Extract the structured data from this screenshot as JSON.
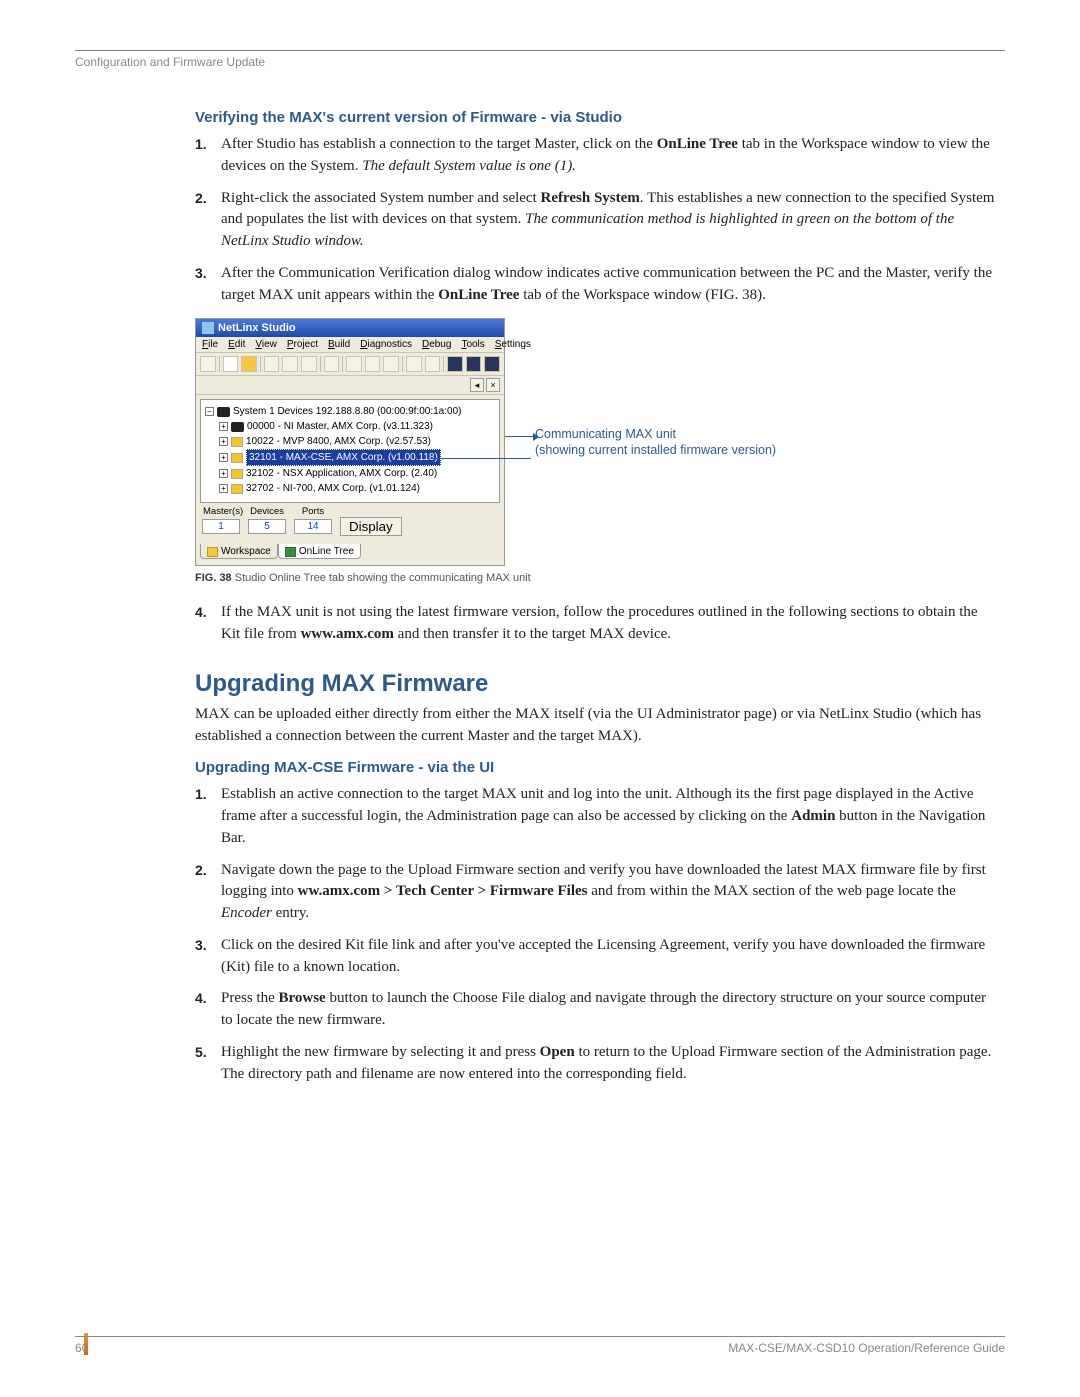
{
  "header": {
    "crumb": "Configuration and Firmware Update"
  },
  "sec1": {
    "title": "Verifying the MAX's current version of Firmware - via Studio",
    "steps": [
      {
        "n": "1.",
        "pre": "After Studio has establish a connection to the target Master, click on the ",
        "b1": "OnLine Tree",
        "mid": " tab in the Workspace window to view the devices on the System. ",
        "i1": "The default System value is one (1)."
      },
      {
        "n": "2.",
        "pre": "Right-click the associated System number and select ",
        "b1": "Refresh System",
        "mid": ". This establishes a new connection to the specified System and populates the list with devices on that system. ",
        "i1": "The communication method is highlighted in green on the bottom of the NetLinx Studio window."
      },
      {
        "n": "3.",
        "pre": "After the Communication Verification dialog window indicates active communication between the PC and the Master, verify the target MAX unit appears within the ",
        "b1": "OnLine Tree",
        "mid": " tab of the Workspace window (FIG. 38).",
        "i1": ""
      }
    ]
  },
  "fig": {
    "title": "NetLinx Studio",
    "menus": [
      "File",
      "Edit",
      "View",
      "Project",
      "Build",
      "Diagnostics",
      "Debug",
      "Tools",
      "Settings"
    ],
    "tree": {
      "root": "System 1 Devices 192.188.8.80 (00:00:9f:00:1a:00)",
      "items": [
        "00000 - NI Master, AMX Corp. (v3.11.323)",
        "10022 - MVP 8400, AMX Corp. (v2.57.53)",
        "32101 - MAX-CSE, AMX Corp. (v1.00.118)",
        "32102 - NSX Application, AMX Corp. (2.40)",
        "32702 - NI-700, AMX Corp. (v1.01.124)"
      ],
      "selectedIndex": 2
    },
    "status": {
      "headers": [
        "Master(s)",
        "Devices",
        "Ports"
      ],
      "values": [
        "1",
        "5",
        "14"
      ],
      "button": "Display"
    },
    "tabs": [
      "Workspace",
      "OnLine Tree"
    ],
    "callout1": "Communicating MAX unit",
    "callout2": "(showing current installed firmware version)",
    "caption_b": "FIG. 38",
    "caption": "  Studio Online Tree tab showing the communicating MAX unit"
  },
  "step4": {
    "n": "4.",
    "pre": "If the MAX unit is not using the latest firmware version, follow the procedures outlined in the following sections to obtain the Kit file from ",
    "b1": "www.amx.com",
    "mid": " and then transfer it to the target MAX device.",
    "i1": ""
  },
  "sec2": {
    "title": "Upgrading MAX Firmware",
    "intro": "MAX can be uploaded either directly from either the MAX itself (via the UI Administrator page) or via NetLinx Studio (which has established a connection between the current Master and the target MAX).",
    "sub": "Upgrading MAX-CSE Firmware - via the UI",
    "steps": [
      {
        "n": "1.",
        "pre": "Establish an active connection to the target MAX unit and log into the unit. Although its the first page displayed in the Active frame after a successful login, the Administration page can also be accessed by clicking on the ",
        "b1": "Admin",
        "mid": " button in the Navigation Bar.",
        "i1": ""
      },
      {
        "n": "2.",
        "pre": "Navigate down the page to the Upload Firmware section and verify you have downloaded the latest MAX firmware file by first logging into ",
        "b1": "ww.amx.com > Tech Center > Firmware Files",
        "mid": " and from within the MAX section of the web page locate the ",
        "i1": "Encoder",
        "post": " entry."
      },
      {
        "n": "3.",
        "pre": "Click on the desired Kit file link and after you've accepted the Licensing Agreement, verify you have downloaded the firmware (Kit) file to a known location.",
        "b1": "",
        "mid": "",
        "i1": ""
      },
      {
        "n": "4.",
        "pre": "Press the ",
        "b1": "Browse",
        "mid": " button to launch the Choose File dialog and navigate through the directory structure on your source computer to locate the new firmware.",
        "i1": ""
      },
      {
        "n": "5.",
        "pre": "Highlight the new firmware by selecting it and press ",
        "b1": "Open",
        "mid": " to return to the Upload Firmware section of the Administration page. The directory path and filename are now entered into the corresponding field.",
        "i1": ""
      }
    ]
  },
  "footer": {
    "page": "60",
    "doc": "MAX-CSE/MAX-CSD10 Operation/Reference Guide"
  }
}
